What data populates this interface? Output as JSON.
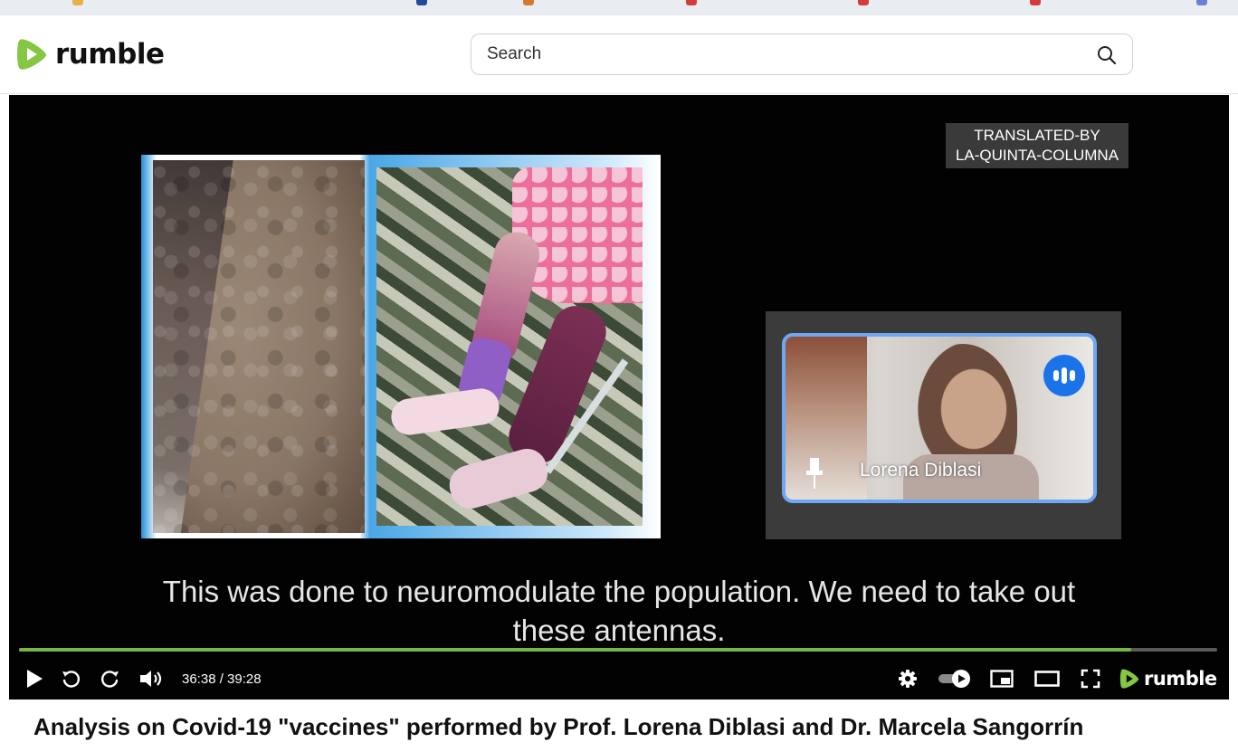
{
  "brand": {
    "name": "rumble",
    "accent": "#85c742"
  },
  "search": {
    "placeholder": "Search",
    "value": ""
  },
  "video": {
    "watermark_line1": "TRANSLATED-BY",
    "watermark_line2": "LA-QUINTA-COLUMNA",
    "webcam_name": "Lorena Diblasi",
    "subtitle_line1": "This was done to neuromodulate the population. We need to take out",
    "subtitle_line2": "these antennas."
  },
  "player": {
    "current_time": "36:38",
    "duration": "39:28",
    "time_display": "36:38 / 39:28",
    "progress_fraction": 0.928,
    "logo_text": "rumble",
    "icons": [
      "play-icon",
      "rewind-icon",
      "forward-icon",
      "volume-icon",
      "settings-icon",
      "autoplay-toggle-icon",
      "miniplayer-icon",
      "theater-mode-icon",
      "fullscreen-icon"
    ]
  },
  "title": "Analysis on Covid-19 \"vaccines\" performed by Prof. Lorena Diblasi and Dr. Marcela Sangorrín"
}
